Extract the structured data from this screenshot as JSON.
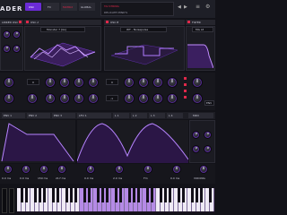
{
  "app": {
    "logo": "ADER",
    "brand_accent": "#9b4dff",
    "danger": "#e0284a"
  },
  "topbar": {
    "tabs": [
      {
        "label": "OSC",
        "active": true
      },
      {
        "label": "FX",
        "active": false
      },
      {
        "label": "MATRIX",
        "active": false
      },
      {
        "label": "GLOBAL",
        "active": false
      }
    ],
    "preset_label": "DELICATE MIND'S",
    "preset_prefix": "TAI STRING"
  },
  "left_header": "LINKED OSC",
  "osc_a": {
    "title": "OSC A",
    "wavetable": "Monster 7 [GL]"
  },
  "osc_b": {
    "title": "OSC B",
    "wavetable": "WT - Noisepulse"
  },
  "filter": {
    "title": "FILTER",
    "type": "MG L6"
  },
  "knob_row": {
    "octave_a": "0",
    "octave_b": "0",
    "semi": "-1",
    "env": "ENV"
  },
  "mod_tabs": [
    "ENV 1",
    "ENV 2",
    "ENV 3",
    "LFO 1",
    "L 1",
    "L 2",
    "L 3",
    "L 4",
    "MIDI"
  ],
  "bottom_values": [
    "0.0 ms",
    "0.0 ms",
    "150 ms",
    "217 ms",
    "0.0 ms",
    "2.0 ms",
    "Fm",
    "0.0 ms"
  ],
  "voicing_label": "VOICING"
}
